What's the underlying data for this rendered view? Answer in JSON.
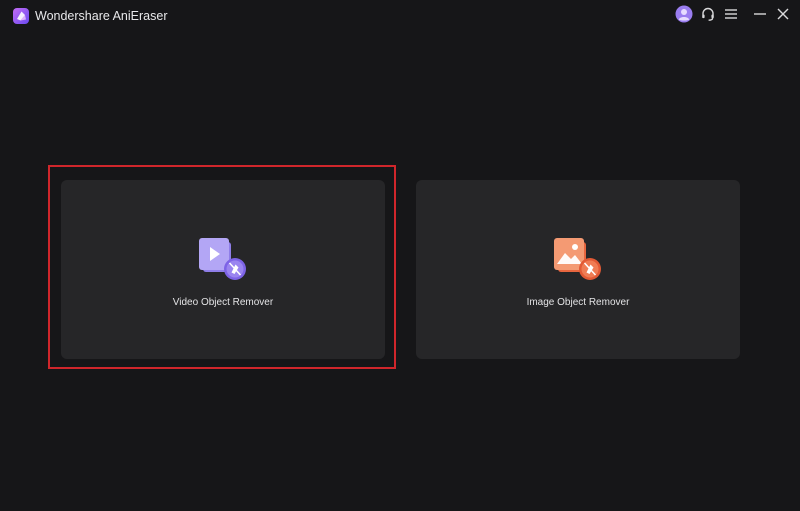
{
  "app": {
    "title": "Wondershare AniEraser"
  },
  "titlebar": {
    "icons": [
      "app-logo-icon",
      "avatar-icon",
      "headset-icon",
      "hamburger-menu-icon",
      "minimize-icon",
      "close-icon"
    ]
  },
  "cards": [
    {
      "label": "Video Object Remover",
      "icon": "video-object-remover-icon",
      "selected": true,
      "accent": "#9b8cf0"
    },
    {
      "label": "Image Object Remover",
      "icon": "image-object-remover-icon",
      "selected": false,
      "accent": "#f27a4e"
    }
  ],
  "colors": {
    "background": "#161618",
    "card": "#262628",
    "selection_outline": "#d0262b",
    "avatar": "#9a7df0"
  }
}
